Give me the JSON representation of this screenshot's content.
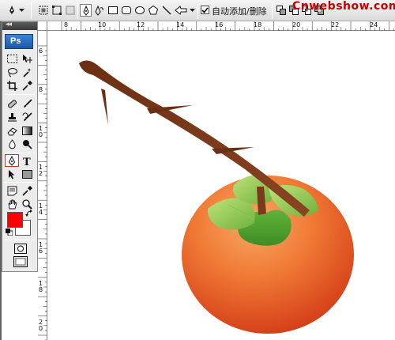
{
  "options_bar": {
    "auto_add_delete_label": "自动添加/删除",
    "auto_add_delete_checked": true,
    "watermark": "Cnwebshow.com"
  },
  "toolbox": {
    "header": "◂◂",
    "logo": "Ps",
    "foreground_color": "#fe0000",
    "background_color": "#ffffff",
    "active_tool": "pen-icon"
  },
  "rulers": {
    "top": [
      "8",
      "10",
      "12",
      "14",
      "16",
      "18",
      "20",
      "22",
      "24"
    ],
    "left": [
      "6",
      "8",
      "1 0",
      "1 2",
      "1 4",
      "1 6",
      "1 8",
      "2 0"
    ]
  },
  "artwork": {
    "colors": {
      "branch": "#7a3a1c",
      "fruit_light": "#f6a05a",
      "fruit_dark": "#d8401a",
      "leaf_light": "#a8d860",
      "leaf_dark": "#4c9e2e"
    }
  }
}
